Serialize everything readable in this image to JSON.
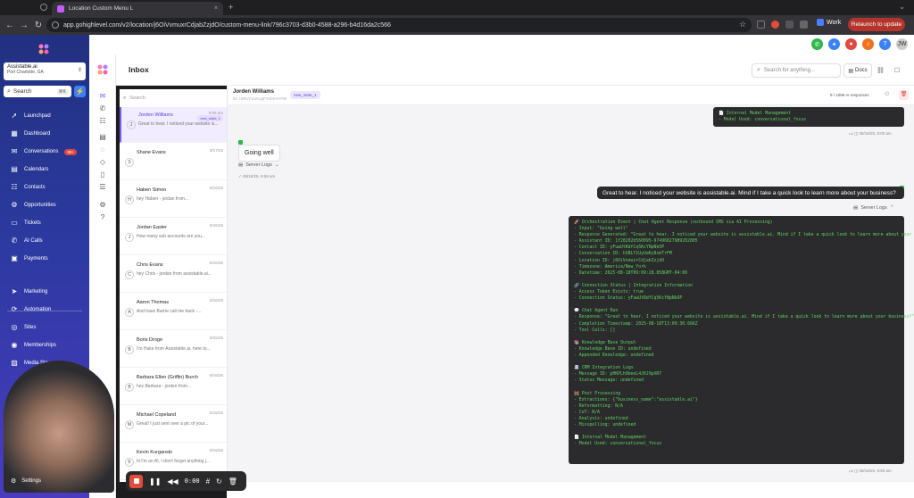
{
  "browser": {
    "tab_title": "Location Custom Menu L",
    "url": "app.gohighlevel.com/v2/location/j6OiVvmuxrCdjabZzjdO/custom-menu-link/796c3703-d3b0-4588-a296-b4d16da2c566",
    "profile_label": "Work",
    "relaunch_label": "Relaunch to update"
  },
  "sidebar": {
    "location_name": "Assistable.ai",
    "location_city": "Port Charlotte, GA",
    "search_label": "Search",
    "search_shortcut": "⌘K",
    "items": [
      {
        "label": "Launchpad",
        "icon": "rocket-icon"
      },
      {
        "label": "Dashboard",
        "icon": "dashboard-icon"
      },
      {
        "label": "Conversations",
        "icon": "chat-icon",
        "badge": "99+"
      },
      {
        "label": "Calendars",
        "icon": "calendar-icon"
      },
      {
        "label": "Contacts",
        "icon": "contacts-icon"
      },
      {
        "label": "Opportunities",
        "icon": "funnel-icon"
      },
      {
        "label": "Tickets",
        "icon": "ticket-icon"
      },
      {
        "label": "AI Calls",
        "icon": "phone-icon"
      },
      {
        "label": "Payments",
        "icon": "card-icon"
      },
      {
        "label": "Marketing",
        "icon": "send-icon"
      },
      {
        "label": "Automation",
        "icon": "automation-icon"
      },
      {
        "label": "Sites",
        "icon": "globe-icon"
      },
      {
        "label": "Memberships",
        "icon": "members-icon"
      },
      {
        "label": "Media Sto",
        "icon": "media-icon"
      }
    ],
    "settings_label": "Settings"
  },
  "inbox": {
    "title": "Inbox",
    "search_placeholder": "Search for anything...",
    "docs_label": "Docs"
  },
  "conversations": {
    "search_placeholder": "Search",
    "list": [
      {
        "initial": "J",
        "name": "Jorden Williams",
        "preview": "Great to hear. I noticed your website is...",
        "date": "9:59 am",
        "tag": "new_state_1",
        "active": true
      },
      {
        "initial": "S",
        "name": "Shane Evans",
        "preview": "",
        "date": "8/17/25"
      },
      {
        "initial": "H",
        "name": "Haben Simon",
        "preview": "hey Haben - jordan from...",
        "date": "8/16/25"
      },
      {
        "initial": "J",
        "name": "Jordan Easler",
        "preview": "How many sub-accounts are you...",
        "date": "8/16/25"
      },
      {
        "initial": "C",
        "name": "Chris Evans",
        "preview": "hey Chris - jordan from assistable.ai...",
        "date": "8/16/25"
      },
      {
        "initial": "A",
        "name": "Aaron Thomas",
        "preview": "And have Barrie call me back -...",
        "date": "8/16/25"
      },
      {
        "initial": "B",
        "name": "Boris Droge",
        "preview": "I'm Hake from Assistable.ai, here to...",
        "date": "8/15/25"
      },
      {
        "initial": "B",
        "name": "Barbara Ellen (Griffin) Burch",
        "preview": "hey Barbara - jorden from...",
        "date": "8/15/25"
      },
      {
        "initial": "M",
        "name": "Michael Copeland",
        "preview": "Great! I just sent over a pic of your...",
        "date": "8/15/25"
      },
      {
        "initial": "K",
        "name": "Kevin Kurganski",
        "preview": "hi I'm an AI, I don't forget anything j...",
        "date": "8/15/25"
      }
    ]
  },
  "chat": {
    "contact_name": "Jorden Williams",
    "contact_id": "ID: rXRcYVcKUgFXnfmYH7W",
    "state_tag": "new_state_1",
    "message_count": "9 / 1096 AI responses",
    "top_box_lines": [
      "📄 Internal Model Management",
      "- Model Used: conversational_focus"
    ],
    "top_box_meta": "08/18/25, 9:00 am",
    "inbound_message": "Going well",
    "server_logs_label": "Server Logs",
    "inbound_meta": "08/18/25, 9:59 am",
    "outbound_message": "Great to hear. I noticed your website is assistable.ai. Mind if I take a quick look to learn more about your business?",
    "log_lines": [
      "🚀 Orchestration Event | Chat Agent Response (outbound SMS via AI Processing)",
      "- Input: \"Going well\"",
      "- Response Generated: \"Great to hear. I noticed your website is assistable.ai. Mind if I take a quick look to learn more about your business?\"",
      "- Assistant ID: 1f28202b560095-97496827989282805",
      "- Contact ID: yFuwUtRdfCq5KcYNpNkOP",
      "- Conversation ID: hSBLY1UyUaKy8xmTrFM",
      "- Location ID: j6OiVvmuxrCdjabZzjdO",
      "- Timezone: America/New_York",
      "- Datetime: 2025-08-18T09:09:28.858GMT-04:00",
      "",
      "🔗 Connection Status | Integration Information",
      "- Access Token Exists: true",
      "- Connection Status: yFuwUtRdfCq5KcYNpNkOP",
      "",
      "💬 Chat Agent Run",
      "- Response: \"Great to hear. I noticed your website is assistable.ai. Mind if I take a quick look to learn more about your business?\"",
      "- Completion Timestamp: 2025-08-18T13:09:30.666Z",
      "- Tool Calls: []",
      "",
      "📚 Knowledge Base Output",
      "- Knowledge Base ID: undefined",
      "- Appended Knowledge: undefined",
      "",
      "📇 CRM Integration Logs",
      "- Message ID: pHKPLh9beeL4J6J9pXR7",
      "- Status Message: undefined",
      "",
      "🧮 Post Processing",
      "- Extractions: {\"business_name\":\"assistable.ai\"}",
      "- Reformatting: N/A",
      "- CoT: N/A",
      "- Analysis: undefined",
      "- Misspelling: undefined",
      "",
      "📄 Internal Model Management",
      "- Model Used: conversational_focus"
    ],
    "log_meta": "08/18/25, 9:59 am"
  },
  "recording": {
    "time": "0:00"
  },
  "colors": {
    "sidebar_top": "#21307f",
    "sidebar_bottom": "#4a3bc0",
    "accent": "#7c5cff",
    "log_text": "#5fd35f",
    "record_red": "#e34b3c"
  }
}
